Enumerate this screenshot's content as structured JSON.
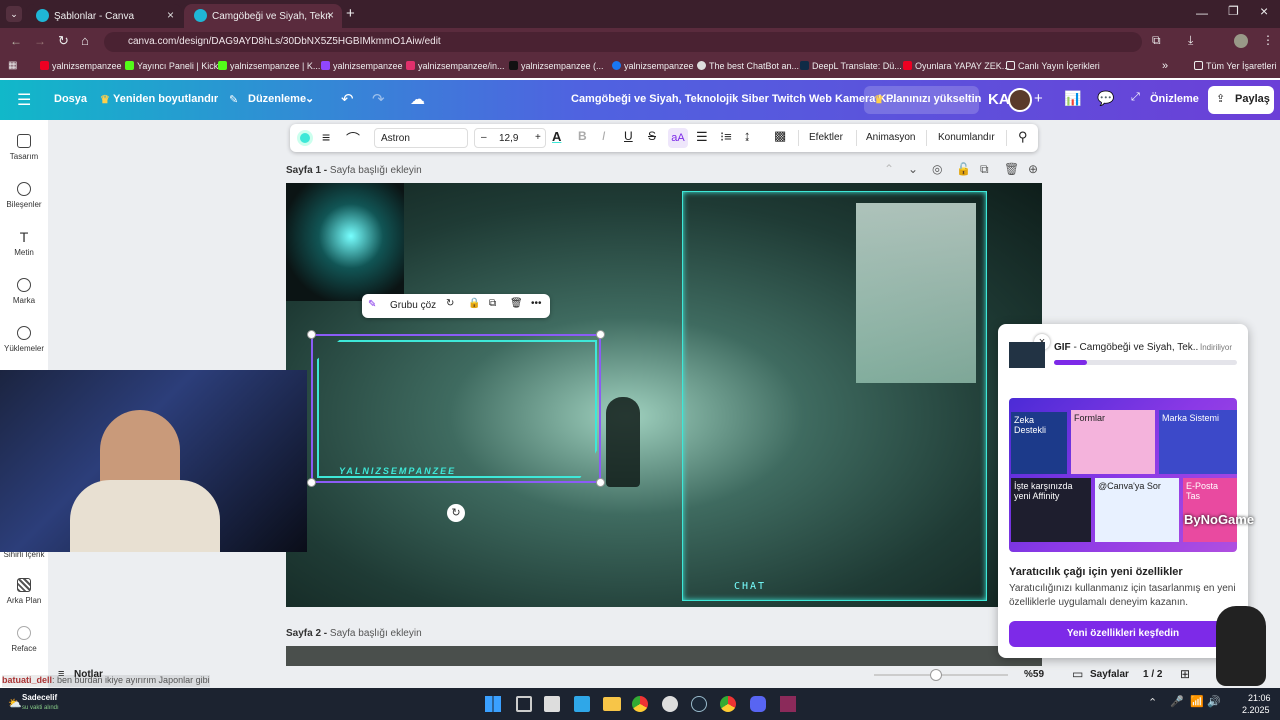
{
  "browser": {
    "tabs": [
      {
        "title": "Şablonlar - Canva"
      },
      {
        "title": "Camgöbeği ve Siyah, Teknolojik"
      }
    ],
    "url": "canva.com/design/DAG9AYD8hLs/30DbNX5Z5HGBIMkmmO1Aiw/edit",
    "bookmarks": [
      "yalnizsempanzee",
      "Yayıncı Paneli | Kick",
      "yalnizsempanzee | K...",
      "yalnizsempanzee",
      "yalnizsempanzee/in...",
      "yalnizsempanzee (...",
      "yalnizsempanzee",
      "The best ChatBot an...",
      "DeepL Translate: Dü...",
      "Oyunlara YAPAY ZEK...",
      "Canlı Yayın İçerikleri",
      "Tüm Yer İşaretleri"
    ]
  },
  "header": {
    "file": "Dosya",
    "resize": "Yeniden boyutlandır",
    "edit": "Düzenleme",
    "title": "Camgöbeği ve Siyah, Teknolojik Siber Twitch Web Kamera K...",
    "upgrade": "Planınızı yükseltin",
    "avatar_initials": "KA",
    "preview": "Önizleme",
    "share": "Paylaş"
  },
  "sidebar": {
    "items": [
      "Tasarım",
      "Bileşenler",
      "Metin",
      "Marka",
      "Yüklemeler",
      "Sihirli İçerik",
      "Arka Plan",
      "Reface"
    ]
  },
  "toolbar": {
    "font": "Astron",
    "size": "12,9",
    "effects": "Efektler",
    "animation": "Animasyon",
    "position": "Konumlandır"
  },
  "pages": {
    "p1_label": "Sayfa 1 -",
    "p1_title": "Sayfa başlığı ekleyin",
    "p2_label": "Sayfa 2 -",
    "p2_title": "Sayfa başlığı ekleyin"
  },
  "group_toolbar": {
    "ungroup": "Grubu çöz"
  },
  "canvas_text": {
    "name": "YALNIZSEMPANZEE",
    "chat": "CHAT"
  },
  "popup": {
    "gif_label": "GIF",
    "gif_title": "- Camgöbeği ve Siyah, Tek...",
    "status": "İndiriliyor",
    "tiles": [
      "Zeka Destekli",
      "Formlar",
      "Marka Sistemi",
      "İşte karşınızda yeni Affinity",
      "@Canva'ya Sor",
      "E-Posta Tas"
    ],
    "heading": "Yaratıcılık çağı için yeni özellikler",
    "body": "Yaratıcılığınızı kullanmanız için tasarlanmış en yeni özelliklerle uygulamalı deneyim kazanın.",
    "cta": "Yeni özellikleri keşfedin"
  },
  "footer": {
    "notes": "Notlar",
    "zoom": "%59",
    "pages": "Sayfalar",
    "page_count": "1 / 2"
  },
  "overlay": {
    "chat_user": "batuati_dell",
    "chat_msg": ": ben burdan ikiye ayırırım Japonlar gibi",
    "watermark": "ByNoGame"
  },
  "taskbar": {
    "weather_title": "Sadecelif",
    "weather_sub": "su vakti alındı",
    "time": "21:06",
    "date": "2.2025"
  },
  "colors": {
    "accent": "#7d2ae8",
    "cyan": "#3ee8d8",
    "tab_bg": "#3b1f2c"
  }
}
